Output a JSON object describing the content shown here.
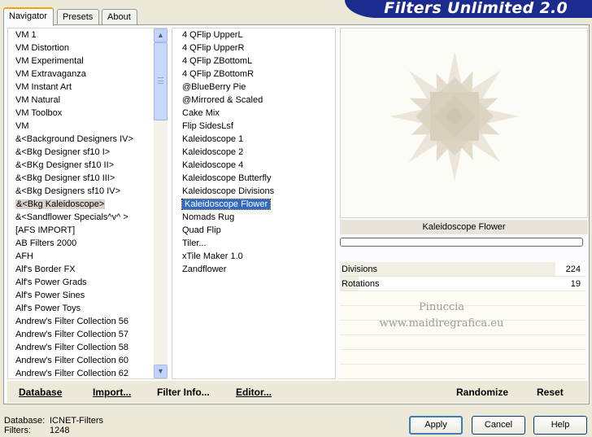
{
  "app": {
    "title": "Filters Unlimited 2.0"
  },
  "tabs": [
    {
      "label": "Navigator"
    },
    {
      "label": "Presets"
    },
    {
      "label": "About"
    }
  ],
  "categories": {
    "items": [
      "VM 1",
      "VM Distortion",
      "VM Experimental",
      "VM Extravaganza",
      "VM Instant Art",
      "VM Natural",
      "VM Toolbox",
      "VM",
      "&<Background Designers IV>",
      "&<Bkg Designer sf10 I>",
      "&<BKg Designer sf10 II>",
      "&<Bkg Designer sf10 III>",
      "&<Bkg Designers sf10 IV>",
      "&<Bkg Kaleidoscope>",
      "&<Sandflower Specials^v^ >",
      "[AFS IMPORT]",
      "AB Filters 2000",
      "AFH",
      "Alf's Border FX",
      "Alf's Power Grads",
      "Alf's Power Sines",
      "Alf's Power Toys",
      "Andrew's Filter Collection 56",
      "Andrew's Filter Collection 57",
      "Andrew's Filter Collection 58",
      "Andrew's Filter Collection 60",
      "Andrew's Filter Collection 62"
    ],
    "selected_index": 13
  },
  "filters": {
    "items": [
      "4 QFlip UpperL",
      "4 QFlip UpperR",
      "4 QFlip ZBottomL",
      "4 QFlip ZBottomR",
      "@BlueBerry Pie",
      "@Mirrored & Scaled",
      "Cake Mix",
      "Flip SidesLsf",
      "Kaleidoscope 1",
      "Kaleidoscope 2",
      "Kaleidoscope 4",
      "Kaleidoscope Butterfly",
      "Kaleidoscope Divisions",
      "Kaleidoscope Flower",
      "Nomads Rug",
      "Quad Flip",
      "Tiler...",
      "xTile Maker 1.0",
      "Zandflower"
    ],
    "selected_index": 13
  },
  "preview": {
    "filter_name": "Kaleidoscope Flower",
    "progress_fraction": 0.0
  },
  "params": [
    {
      "label": "Divisions",
      "value": "224",
      "level": 0.878
    },
    {
      "label": "Rotations",
      "value": "19",
      "level": 0.075
    }
  ],
  "watermark": {
    "line1": "Pinuccia",
    "line2": "www.maidiregrafica.eu"
  },
  "panel_buttons": {
    "database": "Database",
    "import": "Import...",
    "filter_info": "Filter Info...",
    "editor": "Editor...",
    "randomize": "Randomize",
    "reset": "Reset"
  },
  "status": {
    "database_label": "Database:",
    "database_value": "ICNET-Filters",
    "filters_label": "Filters:",
    "filters_value": "1248"
  },
  "dialog_buttons": {
    "apply": "Apply",
    "cancel": "Cancel",
    "help": "Help"
  },
  "colors": {
    "banner": "#1c2b8e",
    "selection": "#316ac5",
    "tab_highlight": "#f1a50b"
  }
}
